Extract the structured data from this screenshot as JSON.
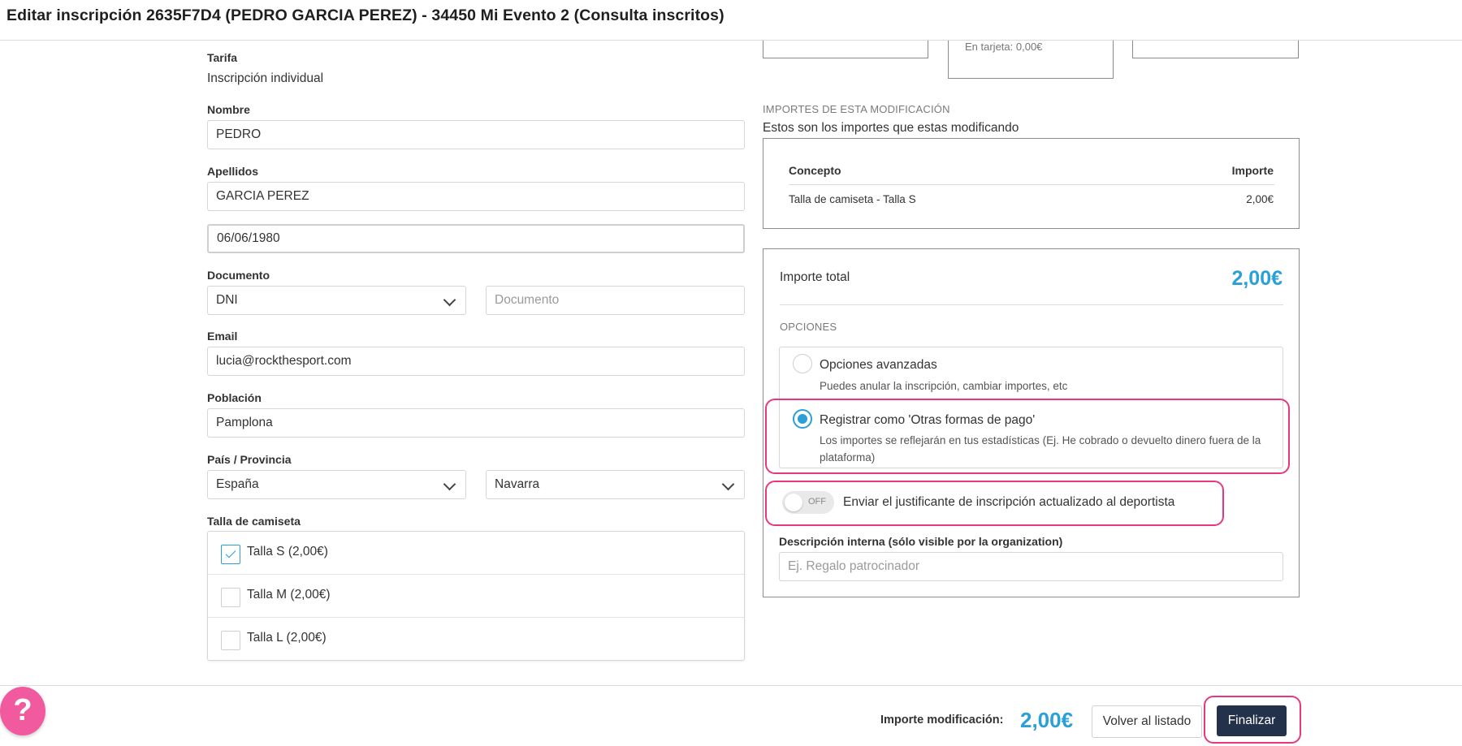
{
  "header": {
    "title": "Editar inscripción 2635F7D4 (PEDRO GARCIA PEREZ) - 34450 Mi Evento 2 (Consulta inscritos)"
  },
  "form": {
    "tarifa_label": "Tarifa",
    "tarifa_value": "Inscripción individual",
    "nombre_label": "Nombre",
    "nombre_value": "PEDRO",
    "apellidos_label": "Apellidos",
    "apellidos_value": "GARCIA PEREZ",
    "fecha_value": "06/06/1980",
    "documento_label": "Documento",
    "documento_tipo": "DNI",
    "documento_placeholder": "Documento",
    "email_label": "Email",
    "email_value": "lucia@rockthesport.com",
    "poblacion_label": "Población",
    "poblacion_value": "Pamplona",
    "pais_label": "País / Provincia",
    "pais_value": "España",
    "provincia_value": "Navarra",
    "talla_label": "Talla de camiseta",
    "tallas": [
      {
        "label": "Talla S (2,00€)",
        "checked": true
      },
      {
        "label": "Talla M (2,00€)",
        "checked": false
      },
      {
        "label": "Talla L (2,00€)",
        "checked": false
      }
    ]
  },
  "summary_top": {
    "tarjeta_text": "En tarjeta: 0,00€"
  },
  "importes": {
    "section_title": "IMPORTES DE ESTA MODIFICACIÓN",
    "subtitle": "Estos son los importes que estas modificando",
    "col_concepto": "Concepto",
    "col_importe": "Importe",
    "rows": [
      {
        "concepto": "Talla de camiseta - Talla S",
        "importe": "2,00€"
      }
    ]
  },
  "total": {
    "label": "Importe total",
    "amount": "2,00€",
    "opciones_title": "OPCIONES",
    "options": [
      {
        "title": "Opciones avanzadas",
        "desc": "Puedes anular la inscripción, cambiar importes, etc",
        "selected": false
      },
      {
        "title": "Registrar como 'Otras formas de pago'",
        "desc": "Los importes se reflejarán en tus estadísticas (Ej. He cobrado o devuelto dinero fuera de la plataforma)",
        "selected": true
      }
    ],
    "toggle_state": "OFF",
    "toggle_label": "Enviar el justificante de inscripción actualizado al deportista",
    "desc_label": "Descripción interna (sólo visible por la organization)",
    "desc_placeholder": "Ej. Regalo patrocinador"
  },
  "footer": {
    "help_glyph": "?",
    "amount_label": "Importe modificación:",
    "amount": "2,00€",
    "back_button": "Volver al listado",
    "finish_button": "Finalizar"
  },
  "colors": {
    "accent": "#2a9fd8",
    "highlight": "#e8377f",
    "primary_button": "#23324a",
    "help_button": "#f25aa0"
  }
}
